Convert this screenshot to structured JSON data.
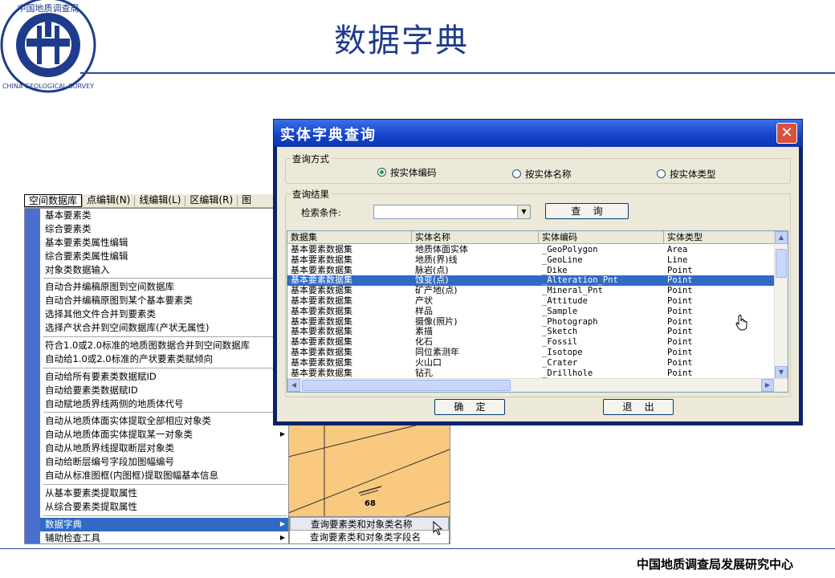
{
  "slide": {
    "title": "数据字典",
    "footer": "中国地质调查局发展研究中心",
    "logo_text_cn": "中国地质调查局",
    "logo_text_en": "CHINA GEOLOGICAL SURVEY"
  },
  "menubar": {
    "items": [
      "空间数据库",
      "点编辑(N)",
      "线编辑(L)",
      "区编辑(R)",
      "图"
    ]
  },
  "menu": {
    "groups": [
      [
        "基本要素类",
        "综合要素类",
        "基本要素类属性编辑",
        "综合要素类属性编辑",
        "对象类数据输入"
      ],
      [
        "自动合并编稿原图到空间数据库",
        "自动合并编稿原图到某个基本要素类",
        "选择其他文件合并到要素类",
        "选择产状合并到空间数据库(产状无属性)"
      ],
      [
        "符合1.0或2.0标准的地质图数据合并到空间数据库",
        "自动给1.0或2.0标准的产状要素类赋倾向"
      ],
      [
        "自动给所有要素类数据赋ID",
        "自动给要素类数据赋ID",
        "自动赋地质界线两侧的地质体代号"
      ],
      [
        "自动从地质体面实体提取全部相应对象类",
        "自动从地质体面实体提取某一对象类",
        "自动从地质界线提取断层对象类",
        "自动给断层编号字段加图幅编号",
        "自动从标准图框(内图框)提取图幅基本信息"
      ],
      [
        "从基本要素类提取属性",
        "从综合要素类提取属性"
      ],
      [
        "数据字典",
        "辅助检查工具"
      ]
    ],
    "submenu": [
      "查询要素类和对象类名称",
      "查询要素类和对象类字段名"
    ]
  },
  "map": {
    "label": "68"
  },
  "dialog": {
    "title": "实体字典查询",
    "close_symbol": "✕",
    "query_mode_label": "查询方式",
    "radio_code": "按实体编码",
    "radio_name": "按实体名称",
    "radio_type": "按实体类型",
    "result_label": "查询结果",
    "search_label": "检索条件:",
    "search_value": "",
    "query_button": "查    询",
    "ok_button": "确    定",
    "exit_button": "退    出",
    "table": {
      "columns": [
        "数据集",
        "实体名称",
        "实体编码",
        "实体类型"
      ],
      "rows": [
        [
          "基本要素数据集",
          "地质体面实体",
          "_GeoPolygon",
          "Area"
        ],
        [
          "基本要素数据集",
          "地质(界)线",
          "_GeoLine",
          "Line"
        ],
        [
          "基本要素数据集",
          "脉岩(点)",
          "_Dike",
          "Point"
        ],
        [
          "基本要素数据集",
          "蚀变(点)",
          "_Alteration_Pnt",
          "Point"
        ],
        [
          "基本要素数据集",
          "矿产地(点)",
          "_Mineral_Pnt",
          "Point"
        ],
        [
          "基本要素数据集",
          "产状",
          "_Attitude",
          "Point"
        ],
        [
          "基本要素数据集",
          "样品",
          "_Sample",
          "Point"
        ],
        [
          "基本要素数据集",
          "摄像(照片)",
          "_Photograph",
          "Point"
        ],
        [
          "基本要素数据集",
          "素描",
          "_Sketch",
          "Point"
        ],
        [
          "基本要素数据集",
          "化石",
          "_Fossil",
          "Point"
        ],
        [
          "基本要素数据集",
          "同位素测年",
          "_Isotope",
          "Point"
        ],
        [
          "基本要素数据集",
          "火山口",
          "_Crater",
          "Point"
        ],
        [
          "基本要素数据集",
          "钻孔",
          "_Drillhole",
          "Point"
        ]
      ],
      "selected_row": 3
    }
  }
}
